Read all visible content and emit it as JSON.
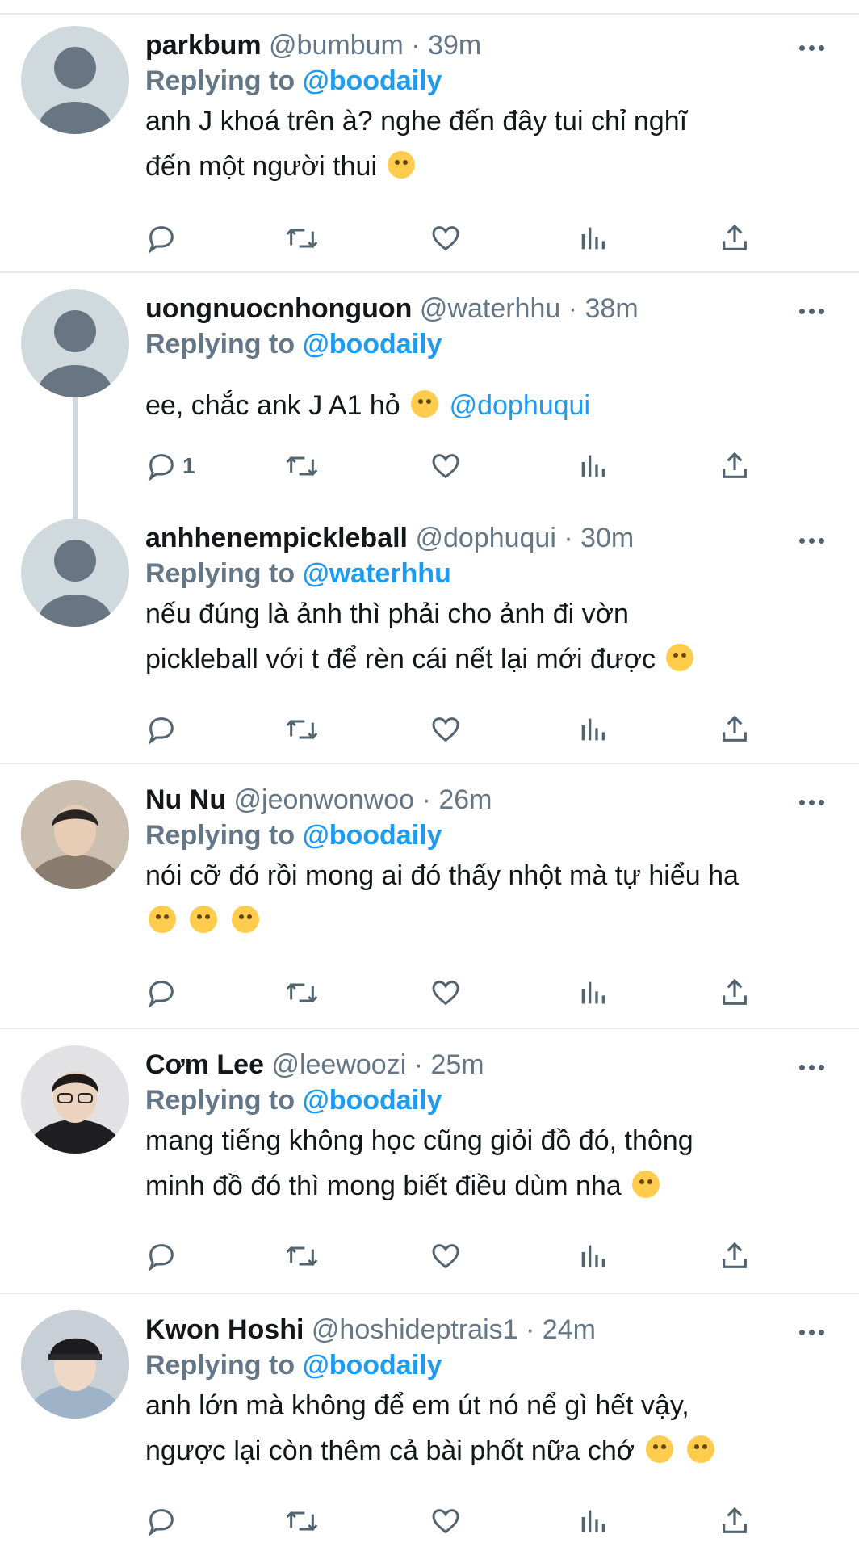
{
  "tweets": [
    {
      "name": "parkbum",
      "handle": "@bumbum",
      "time": "39m",
      "replying_label": "Replying to ",
      "reply_to": "@boodaily",
      "text_1": "anh J khoá trên à? nghe đến đây tui chỉ nghĩ",
      "text_2": "đến một người thui",
      "reply_count": ""
    },
    {
      "name": "uongnuocnhonguon",
      "handle": "@waterhhu",
      "time": "38m",
      "replying_label": "Replying to ",
      "reply_to": "@boodaily",
      "text_1": "ee, chắc ank J A1 hỏ",
      "mention": "@dophuqui",
      "reply_count": "1"
    },
    {
      "name": "anhhenempickleball",
      "handle": "@dophuqui",
      "time": "30m",
      "replying_label": "Replying to ",
      "reply_to": "@waterhhu",
      "text_1": "nếu đúng là ảnh thì phải cho ảnh đi vờn",
      "text_2": "pickleball với t để rèn cái nết lại mới được",
      "reply_count": ""
    },
    {
      "name": "Nu Nu",
      "handle": "@jeonwonwoo",
      "time": "26m",
      "replying_label": "Replying to ",
      "reply_to": "@boodaily",
      "text_1": "nói cỡ đó rồi mong ai đó thấy nhột mà tự hiểu ha",
      "reply_count": ""
    },
    {
      "name": "Cơm Lee",
      "handle": "@leewoozi",
      "time": "25m",
      "replying_label": "Replying to ",
      "reply_to": "@boodaily",
      "text_1": "mang tiếng không học cũng giỏi đồ đó, thông",
      "text_2": "minh đồ đó thì mong biết điều dùm nha",
      "reply_count": ""
    },
    {
      "name": "Kwon Hoshi",
      "handle": "@hoshideptrais1",
      "time": "24m",
      "replying_label": "Replying to ",
      "reply_to": "@boodaily",
      "text_1": "anh lớn mà không để em út nó nể gì hết vậy,",
      "text_2": "ngược lại còn thêm cả bài phốt nữa chớ",
      "reply_count": ""
    }
  ],
  "separator": " · ",
  "colors": {
    "accent": "#1d9bf0",
    "muted": "#657786",
    "divider": "#e6e9ec",
    "avatar_default": "#cfd9de"
  },
  "icons": [
    "reply-icon",
    "retweet-icon",
    "like-icon",
    "views-icon",
    "share-icon",
    "more-icon"
  ]
}
